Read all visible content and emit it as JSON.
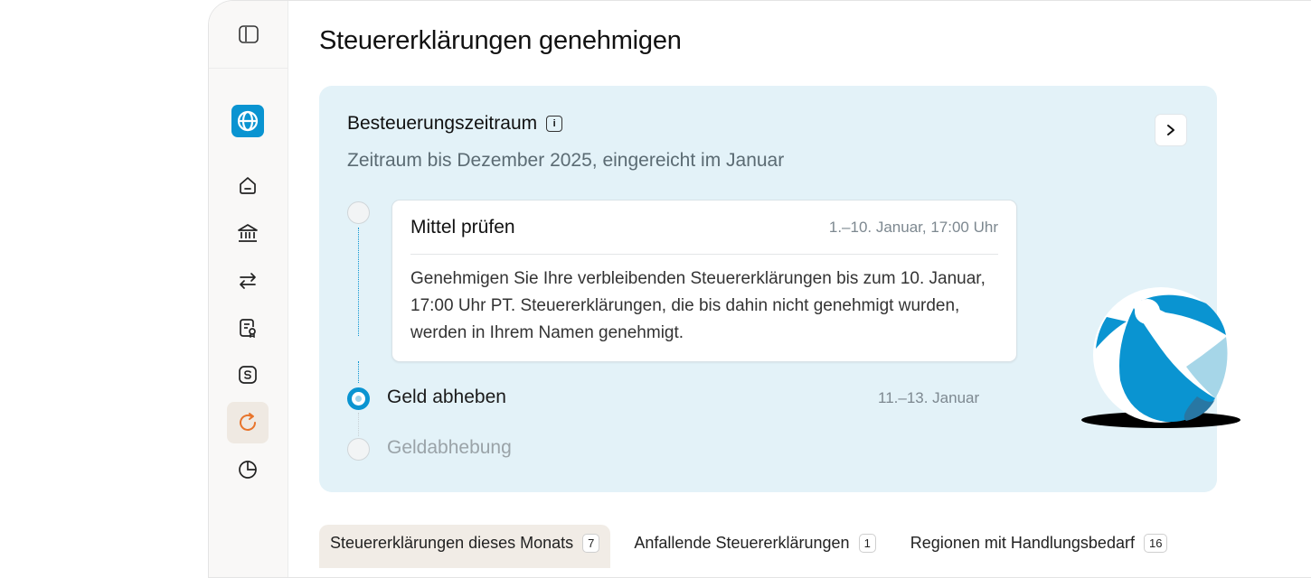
{
  "page": {
    "title": "Steuererklärungen genehmigen"
  },
  "sidebar": {
    "items": [
      {
        "name": "home-icon"
      },
      {
        "name": "bank-icon"
      },
      {
        "name": "transfer-icon"
      },
      {
        "name": "document-icon"
      },
      {
        "name": "dollar-icon"
      },
      {
        "name": "refresh-icon",
        "active": true
      },
      {
        "name": "pie-chart-icon"
      }
    ]
  },
  "card": {
    "title": "Besteuerungszeitraum",
    "subtitle": "Zeitraum bis Dezember 2025, eingereicht im Januar",
    "steps": [
      {
        "title": "Mittel prüfen",
        "date": "1.–10. Januar, 17:00 Uhr",
        "body": "Genehmigen Sie Ihre verbleibenden Steuererklärungen bis zum 10. Januar, 17:00 Uhr PT. Steuererklärungen, die bis dahin nicht genehmigt wurden, werden in Ihrem Namen genehmigt."
      },
      {
        "title": "Geld abheben",
        "date": "11.–13. Januar"
      },
      {
        "title": "Geldabhebung"
      }
    ]
  },
  "tabs": [
    {
      "label": "Steuererklärungen dieses Monats",
      "count": "7",
      "active": true
    },
    {
      "label": "Anfallende Steuererklärungen",
      "count": "1"
    },
    {
      "label": "Regionen mit Handlungsbedarf",
      "count": "16"
    }
  ],
  "colors": {
    "accent": "#0a94d1",
    "card_bg": "#e3f2f8",
    "active_nav_bg": "#efe9e2",
    "active_nav_icon": "#e8742b"
  }
}
